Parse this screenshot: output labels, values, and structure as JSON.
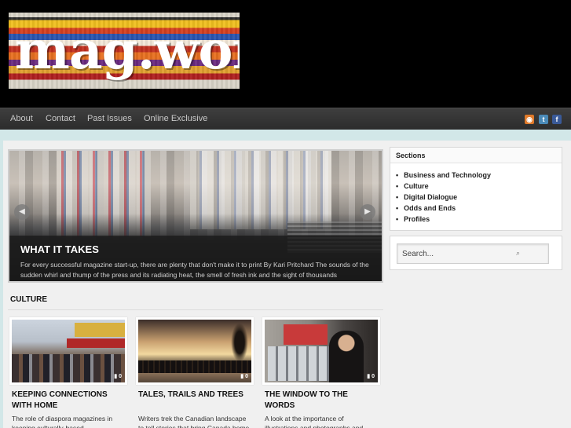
{
  "site": {
    "logo_text": "mag.world"
  },
  "nav": {
    "items": [
      {
        "label": "About"
      },
      {
        "label": "Contact"
      },
      {
        "label": "Past Issues"
      },
      {
        "label": "Online Exclusive"
      }
    ],
    "social": [
      {
        "icon": "rss-icon",
        "glyph": "◉",
        "color": "#e07a2a"
      },
      {
        "icon": "twitter-icon",
        "glyph": "t",
        "color": "#4a8ab8"
      },
      {
        "icon": "facebook-icon",
        "glyph": "f",
        "color": "#3a5a98"
      }
    ]
  },
  "slider": {
    "title": "WHAT IT TAKES",
    "excerpt": "For every successful magazine start-up, there are plenty that don't make it to print By Kari Pritchard The sounds of the sudden whirl and thump of the press and its radiating heat, the smell of fresh ink and the sight of thousands",
    "prev_glyph": "◀",
    "next_glyph": "▶"
  },
  "culture": {
    "heading": "CULTURE",
    "cards": [
      {
        "title": "KEEPING CONNECTIONS WITH HOME",
        "excerpt": "The role of diaspora magazines in keeping culturally-based",
        "comments": "0"
      },
      {
        "title": "TALES, TRAILS AND TREES",
        "excerpt": "Writers trek the Canadian landscape to tell stories that bring Canada home to Canadians By",
        "comments": "0"
      },
      {
        "title": "THE WINDOW TO THE WORDS",
        "excerpt": "A look at the importance of illustrations and photographs and",
        "comments": "0"
      }
    ]
  },
  "sidebar": {
    "sections_title": "Sections",
    "sections": [
      {
        "label": "Business and Technology"
      },
      {
        "label": "Culture"
      },
      {
        "label": "Digital Dialogue"
      },
      {
        "label": "Odds and Ends"
      },
      {
        "label": "Profiles"
      }
    ],
    "search_placeholder": "Search...",
    "search_icon_glyph": "⌕"
  }
}
